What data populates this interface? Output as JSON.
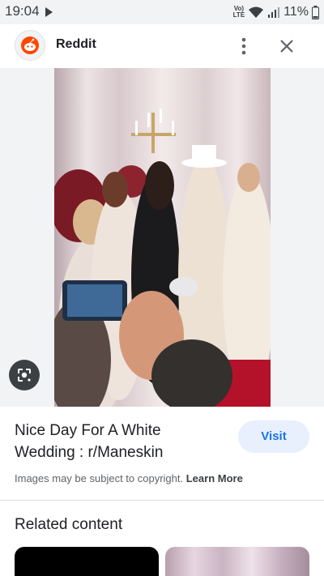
{
  "status_bar": {
    "time": "19:04",
    "network_label": "Vo) LTE",
    "battery": "11%"
  },
  "source": {
    "name": "Reddit",
    "logo_icon": "reddit-logo-icon",
    "more_icon": "more-vert-icon",
    "close_icon": "close-icon"
  },
  "image": {
    "lens_icon": "google-lens-icon"
  },
  "result": {
    "title": "Nice Day For A White Wedding : r/Maneskin",
    "visit_label": "Visit",
    "copyright_text": "Images may be subject to copyright.",
    "learn_more_label": "Learn More"
  },
  "related": {
    "heading": "Related content"
  },
  "colors": {
    "accent": "#1a73e8",
    "visit_bg": "#e8f0fe",
    "reddit_orange": "#ff4500",
    "status_bg": "#f1f3f4"
  }
}
